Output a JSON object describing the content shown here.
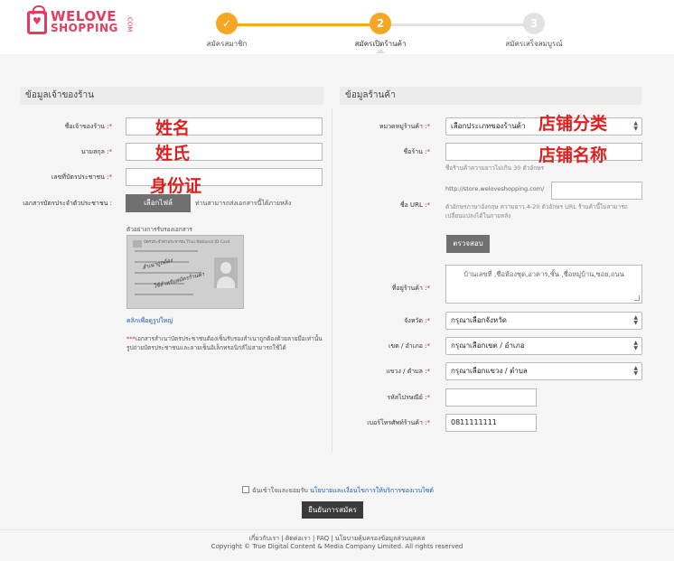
{
  "header": {
    "logo_line1": "WELOVE",
    "logo_line2": "SHOPPING",
    "logo_suffix": ".COM",
    "steps": [
      {
        "label": "สมัครสมาชิก",
        "symbol": "✓",
        "state": "done"
      },
      {
        "label": "สมัครเปิดร้านค้า",
        "symbol": "2",
        "state": "current"
      },
      {
        "label": "สมัครเสร็จสมบูรณ์",
        "symbol": "3",
        "state": "pending"
      }
    ],
    "colors": {
      "accent": "#f5a623",
      "pending": "#e2e2e2",
      "brand": "#e03d61"
    }
  },
  "owner": {
    "section_title": "ข้อมูลเจ้าของร้าน",
    "name_label": "ชื่อเจ้าของร้าน :",
    "surname_label": "นามสกุล :",
    "id_label": "เลขที่บัตรประชาชน :",
    "doc_label": "เอกสารบัตรประจำตัวประชาชน :",
    "file_button": "เลือกไฟล์",
    "file_status": "ท่านสามารถส่งเอกสารนี้ได้ภายหลัง",
    "sample_title": "ตัวอย่างการรับรองเอกสาร",
    "card_header": "บัตรประจำตัวประชาชน Thai National ID Card",
    "card_signature_1": "สำเนาถูกต้อง",
    "card_signature_2": "ใช้สำหรับสมัครร้านค้า",
    "zoom_link": "คลิกเพื่อดูรูปใหญ่",
    "note_stars": "***",
    "note_text": "เอกสารสำเนาบัตรประชาชนต้องเซ็นรับรองสำเนาถูกต้องด้วยลายมือเท่านั้น รูปถ่ายบัตรประชาชนและลายเซ็นอิเล็กทรอนิกส์ไม่สามารถใช้ได้",
    "required_mark": "*",
    "annotations": {
      "name": "姓名",
      "surname": "姓氏",
      "id": "身份证"
    }
  },
  "shop": {
    "section_title": "ข้อมูลร้านค้า",
    "category_label": "หมวดหมู่ร้านค้า :",
    "category_value": "เลือกประเภทของร้านค้า",
    "shopname_label": "ชื่อร้าน :",
    "shopname_hint": "ชื่อร้านค้าความยาวไม่เกิน 30 ตัวอักษร",
    "url_label": "ชื่อ URL :",
    "url_prefix": "http://store.weloveshopping.com/",
    "url_hint_1": "ตัวอักษรภาษาอังกฤษ ความยาว 4-20 ตัวอักษร URL ร้านค้านี้ไม่สามารถ",
    "url_hint_2": "เปลี่ยนแปลงได้ในภายหลัง",
    "check_button": "ตรวจสอบ",
    "address_label": "ที่อยู่ร้านค้า :",
    "address_placeholder": "บ้านเลขที่ ,ชื่อห้องชุด,อาคาร,ชั้น ,ชื่อหมู่บ้าน,ซอย,ถนน",
    "province_label": "จังหวัด :",
    "province_value": "กรุณาเลือกจังหวัด",
    "district_label": "เขต / อำเภอ :",
    "district_value": "กรุณาเลือกเขต / อำเภอ",
    "subdistrict_label": "แขวง / ตำบล :",
    "subdistrict_value": "กรุณาเลือกแขวง / ตำบล",
    "postcode_label": "รหัสไปรษณีย์ :",
    "phone_label": "เบอร์โทรศัพท์ร้านค้า :",
    "phone_value": "0811111111",
    "required_mark": "*",
    "annotations": {
      "category": "店铺分类",
      "name": "店铺名称"
    }
  },
  "agreement": {
    "text": "ฉันเข้าใจและยอมรับ",
    "link": "นโยบายและเงื่อนไขการให้บริการของเวบไซต์",
    "submit": "ยืนยันการสมัคร"
  },
  "footer": {
    "links": "เกี่ยวกับเรา | ติดต่อเรา | FAQ | นโยบายคุ้มครองข้อมูลส่วนบุคคล",
    "copyright": "Copyright © True Digital Content & Media Company Limited. All rights reserved"
  }
}
